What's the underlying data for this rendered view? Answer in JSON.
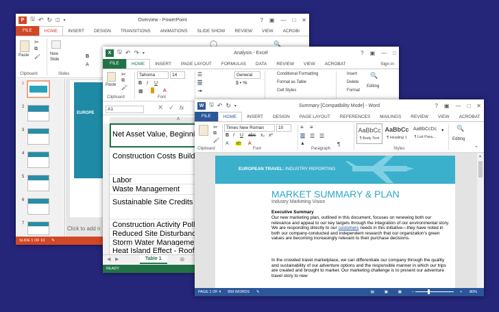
{
  "colors": {
    "background": "#252579",
    "powerpoint": "#d24726",
    "excel": "#217346",
    "word": "#2b579a"
  },
  "powerpoint": {
    "title": "Overview - PowerPoint",
    "file_tab": "FILE",
    "tabs": [
      "HOME",
      "INSERT",
      "DESIGN",
      "TRANSITIONS",
      "ANIMATIONS",
      "SLIDE SHOW",
      "REVIEW",
      "VIEW",
      "ACROB/"
    ],
    "paste_label": "Paste",
    "new_slide_label": "New Slide",
    "clipboard_label": "Clipboard",
    "slides_label": "Slides",
    "slide_numbers": [
      "1",
      "2",
      "3",
      "4",
      "5",
      "6",
      "7"
    ],
    "slide_title_text": "EUROPE",
    "notes_placeholder": "Click to add n",
    "status": "SLIDE 1 OF 10"
  },
  "excel": {
    "title": "Analysis - Excel",
    "file_tab": "FILE",
    "tabs": [
      "HOME",
      "INSERT",
      "PAGE LAYOUT",
      "FORMULAS",
      "DATA",
      "REVIEW",
      "VIEW",
      "ACROBAT"
    ],
    "sign_in": "Sign in",
    "font_name": "Tahoma",
    "font_size": "14",
    "number_format": "General",
    "paste_label": "Paste",
    "conditional_formatting": "Conditional Formatting",
    "format_as_table": "Format as Table",
    "cell_styles": "Cell Styles",
    "insert_label": "Insert",
    "delete_label": "Delete",
    "format_label": "Format",
    "editing_label": "Editing",
    "clipboard_label": "Clipboard",
    "font_label": "Font",
    "name_box": "A1",
    "fx": "fx",
    "col_a": "A",
    "rows": [
      {
        "num": "",
        "text": "Net Asset Value, Beginning"
      },
      {
        "num": "",
        "text": "Construction Costs Building"
      },
      {
        "num": "",
        "text": "Labor"
      },
      {
        "num": "",
        "text": "Waste Management"
      },
      {
        "num": "",
        "text": "Sustainable Site Credits S"
      },
      {
        "num": "",
        "text": "Construction Activity Pollu"
      },
      {
        "num": "",
        "text": "Reduced Site Disturbance"
      },
      {
        "num": "",
        "text": "Storm Water Management"
      },
      {
        "num": "",
        "text": "Heat Island Effect - Roof"
      }
    ],
    "row_nums": [
      "1",
      "2",
      "3",
      "4",
      "5",
      "6",
      "7",
      "8",
      "9",
      "10",
      "11",
      "12",
      "13",
      "14",
      "15",
      "16"
    ],
    "sheet_tab": "Table 1",
    "status": "READY"
  },
  "word": {
    "title": "Summary [Compatibility Mode] - Word",
    "file_tab": "FILE",
    "tabs": [
      "HOME",
      "INSERT",
      "DESIGN",
      "PAGE LAYOUT",
      "REFERENCES",
      "MAILINGS",
      "REVIEW",
      "VIEW",
      "ACROBAT"
    ],
    "font_name": "Times New Roman",
    "font_size": "10",
    "styles": [
      {
        "preview": "AaBbCc",
        "name": "¶ Body Text"
      },
      {
        "preview": "AaBbCc",
        "name": "¶ Heading 1"
      },
      {
        "preview": "AaBbCcDc",
        "name": "¶ List Para..."
      }
    ],
    "editing_label": "Editing",
    "clipboard_label": "Clipboard",
    "font_label": "Font",
    "paragraph_label": "Paragraph",
    "styles_label": "Styles",
    "banner": "EUROPEAN TRAVEL: INDUSTRY REPORTING",
    "banner_bold": "EUROPEAN TRAVEL:",
    "banner_rest": " INDUSTRY REPORTING",
    "doc_title": "MARKET SUMMARY & PLAN",
    "doc_subtitle": "Industry Marketing Vision",
    "section_heading": "Executive Summary",
    "para1_before_link": "Our new marketing plan, outlined in this document, focuses on renewing both our relevance and appeal to our key targets through the integration of our environmental story. We are responding directly to our ",
    "para1_link": "customers",
    "para1_after_link": " needs in this initiative—they have noted in both our company-conducted and independent research that our organization's green values are becoming increasingly relevant to their purchase decisions.",
    "para2": "In the crowded travel marketplace, we can differentiate our company through the quality and sustainability of our adventure options and the responsible manner in which our trips are created and brought to market. Our marketing challenge is to present our adventure travel story to new",
    "status_page": "PAGE 1 OF 4",
    "status_words": "899 WORDS",
    "zoom": "80%"
  }
}
